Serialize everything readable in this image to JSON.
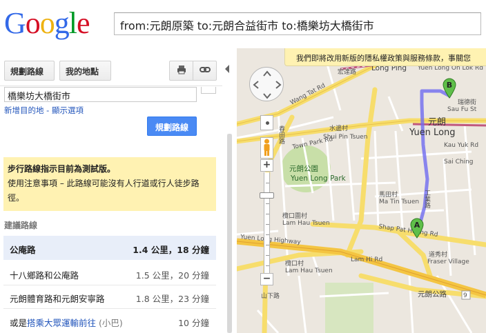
{
  "header": {
    "logo_letters": [
      {
        "ch": "G",
        "color": "#3369e8"
      },
      {
        "ch": "o",
        "color": "#d50f25"
      },
      {
        "ch": "o",
        "color": "#eeb211"
      },
      {
        "ch": "g",
        "color": "#3369e8"
      },
      {
        "ch": "l",
        "color": "#009925"
      },
      {
        "ch": "e",
        "color": "#d50f25"
      }
    ],
    "search_value": "from:元朗原築 to:元朗合益街市 to:橋樂坊大橋街市"
  },
  "left_panel": {
    "route_button": "規劃路線",
    "mymaps_button": "我的地點",
    "print_icon": "printer-icon",
    "link_icon": "link-icon",
    "destination_value": "橋樂坊大橋街市",
    "add_destination": "新增目的地 - 顯示選項",
    "go_button": "規劃路線",
    "notice_title": "步行路線指示目前為測試版。",
    "notice_body": "使用注意事項 – 此路線可能沒有人行道或行人徒步路徑。",
    "suggest_heading": "建議路線",
    "routes": [
      {
        "name": "公庵路",
        "dist": "1.4 公里，18 分鐘"
      },
      {
        "name": "十八鄉路和公庵路",
        "dist": "1.5 公里，20 分鐘"
      },
      {
        "name": "元朗體育路和元朗安寧路",
        "dist": "1.8 公里，23 分鐘"
      },
      {
        "name_prefix": "或是",
        "name_link": "搭乘大眾運輸前往",
        "name_suffix": "(小巴)",
        "dist": "10 分鐘"
      }
    ]
  },
  "map": {
    "privacy_banner": "我們即將改用新版的隱私權政策與服務條款，事關您",
    "labels": {
      "long_ping": "Long Ping",
      "yuen_long_on_lok": "Yuen Long On Lok Rd",
      "hung_tin": "宏達路",
      "wang_tat": "Wang Tat Rd",
      "sau_fu": "Sau Fu St",
      "sau_fu_cn": "瑞德街",
      "yuen_long_cn": "元朗",
      "yuen_long": "Yuen Long",
      "shui_pin_cn": "水邊村",
      "shui_pin": "Shui Pin Tsuen",
      "kau_yuk": "Kau Yuk Rd",
      "town_park": "Town Park Rd",
      "yuen_long_park_cn": "元朗公園",
      "yuen_long_park": "Yuen Long Park",
      "sai_ching": "Sai Ching",
      "ma_tin_cn": "馬田村",
      "ma_tin": "Ma Tin Tsuen",
      "lam_hau_cn": "欖口圍村",
      "lam_hau": "Lam Hau Tsuen",
      "shap_pat_heung": "Shap Pat Heung Rd",
      "yuen_long_highway": "Yuen Long Highway",
      "lam_hi": "Lam Hi Rd",
      "fraser_village_cn": "道秀村",
      "fraser_village": "Fraser Village",
      "lam_hau_tsuen_cn": "欖口村",
      "lam_hau_tsuen": "Lam Hau Tsuen",
      "yuen_long_kau_cn": "元朗公路",
      "ma_tai": "Ma Tai Rd",
      "kam_tin": "Kam Tin Rd",
      "gong_bei": "工業路",
      "shan_ha": "山下路",
      "chun_tin": "春田路",
      "route_number": "9"
    },
    "marker_a": "A",
    "marker_b": "B",
    "pan_control": "pan-control",
    "zoom_in": "+",
    "zoom_out": "−"
  }
}
